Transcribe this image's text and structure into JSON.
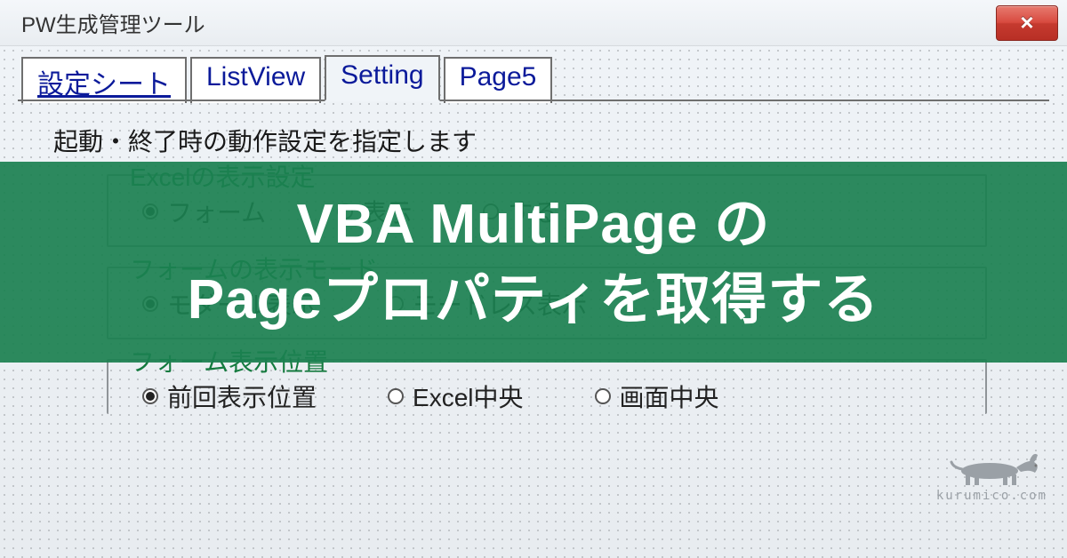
{
  "window": {
    "title": "PW生成管理ツール",
    "close_icon": "×"
  },
  "tabs": [
    {
      "label": "設定シート",
      "active": false
    },
    {
      "label": "ListView",
      "active": false
    },
    {
      "label": "Setting",
      "active": true
    },
    {
      "label": "Page5",
      "active": false
    }
  ],
  "page": {
    "heading": "起動・終了時の動作設定を指定します",
    "group1": {
      "legend": "Excelの表示設定",
      "options": [
        {
          "label": "フォーム",
          "checked": true
        },
        {
          "label": "表示",
          "checked": false
        },
        {
          "label": "する",
          "checked": false
        }
      ]
    },
    "group2": {
      "legend": "フォームの表示モード",
      "options": [
        {
          "label": "モダール表示",
          "checked": true
        },
        {
          "label": "モードレス表示",
          "checked": false
        }
      ]
    },
    "group3": {
      "legend": "フォーム表示位置",
      "options": [
        {
          "label": "前回表示位置",
          "checked": true
        },
        {
          "label": "Excel中央",
          "checked": false
        },
        {
          "label": "画面中央",
          "checked": false
        }
      ]
    }
  },
  "overlay": {
    "line1": "VBA MultiPage の",
    "line2": "Pageプロパティを取得する"
  },
  "watermark": {
    "url": "kurumico.com",
    "icon": "dachshund-icon"
  }
}
